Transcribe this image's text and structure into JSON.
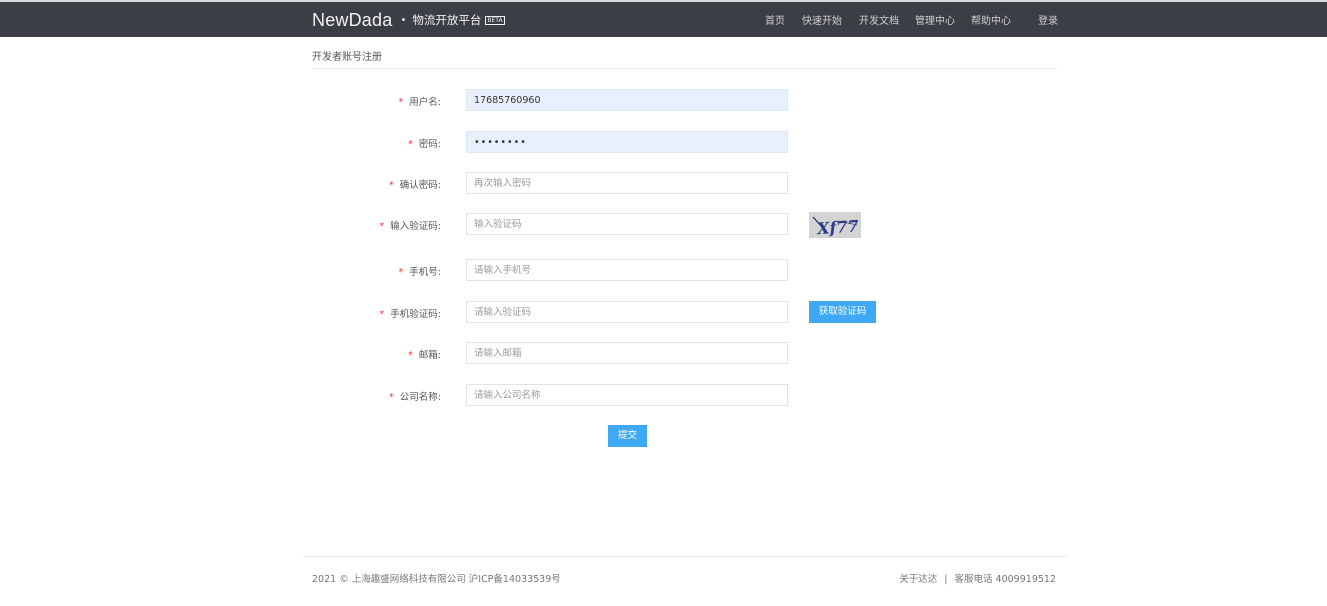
{
  "header": {
    "logo_main": "NewDada",
    "logo_dot": "•",
    "logo_sub": "物流开放平台",
    "logo_badge": "BETA",
    "nav": [
      "首页",
      "快速开始",
      "开发文档",
      "管理中心",
      "帮助中心"
    ],
    "login": "登录"
  },
  "page": {
    "title": "开发者账号注册"
  },
  "form": {
    "required_mark": "*",
    "fields": [
      {
        "label": "用户名:",
        "value": "17685760960",
        "placeholder": ""
      },
      {
        "label": "密码:",
        "value": "••••••••",
        "placeholder": ""
      },
      {
        "label": "确认密码:",
        "value": "",
        "placeholder": "再次输入密码"
      },
      {
        "label": "输入验证码:",
        "value": "",
        "placeholder": "输入验证码"
      },
      {
        "label": "手机号:",
        "value": "",
        "placeholder": "请输入手机号"
      },
      {
        "label": "手机验证码:",
        "value": "",
        "placeholder": "请输入验证码"
      },
      {
        "label": "邮箱:",
        "value": "",
        "placeholder": "请输入邮箱"
      },
      {
        "label": "公司名称:",
        "value": "",
        "placeholder": "请输入公司名称"
      }
    ],
    "captcha_text": "Xf77",
    "sms_button": "获取验证码",
    "submit": "提交"
  },
  "footer": {
    "copyright": "2021 © 上海趣盛网络科技有限公司 沪ICP备14033539号",
    "about": "关于达达",
    "separator": "|",
    "hotline": "客服电话 4009919512"
  },
  "colors": {
    "topbar": "#3b3e44",
    "primary": "#3fa9f5",
    "required": "#e4393c",
    "autofill": "#e8f0fe"
  }
}
